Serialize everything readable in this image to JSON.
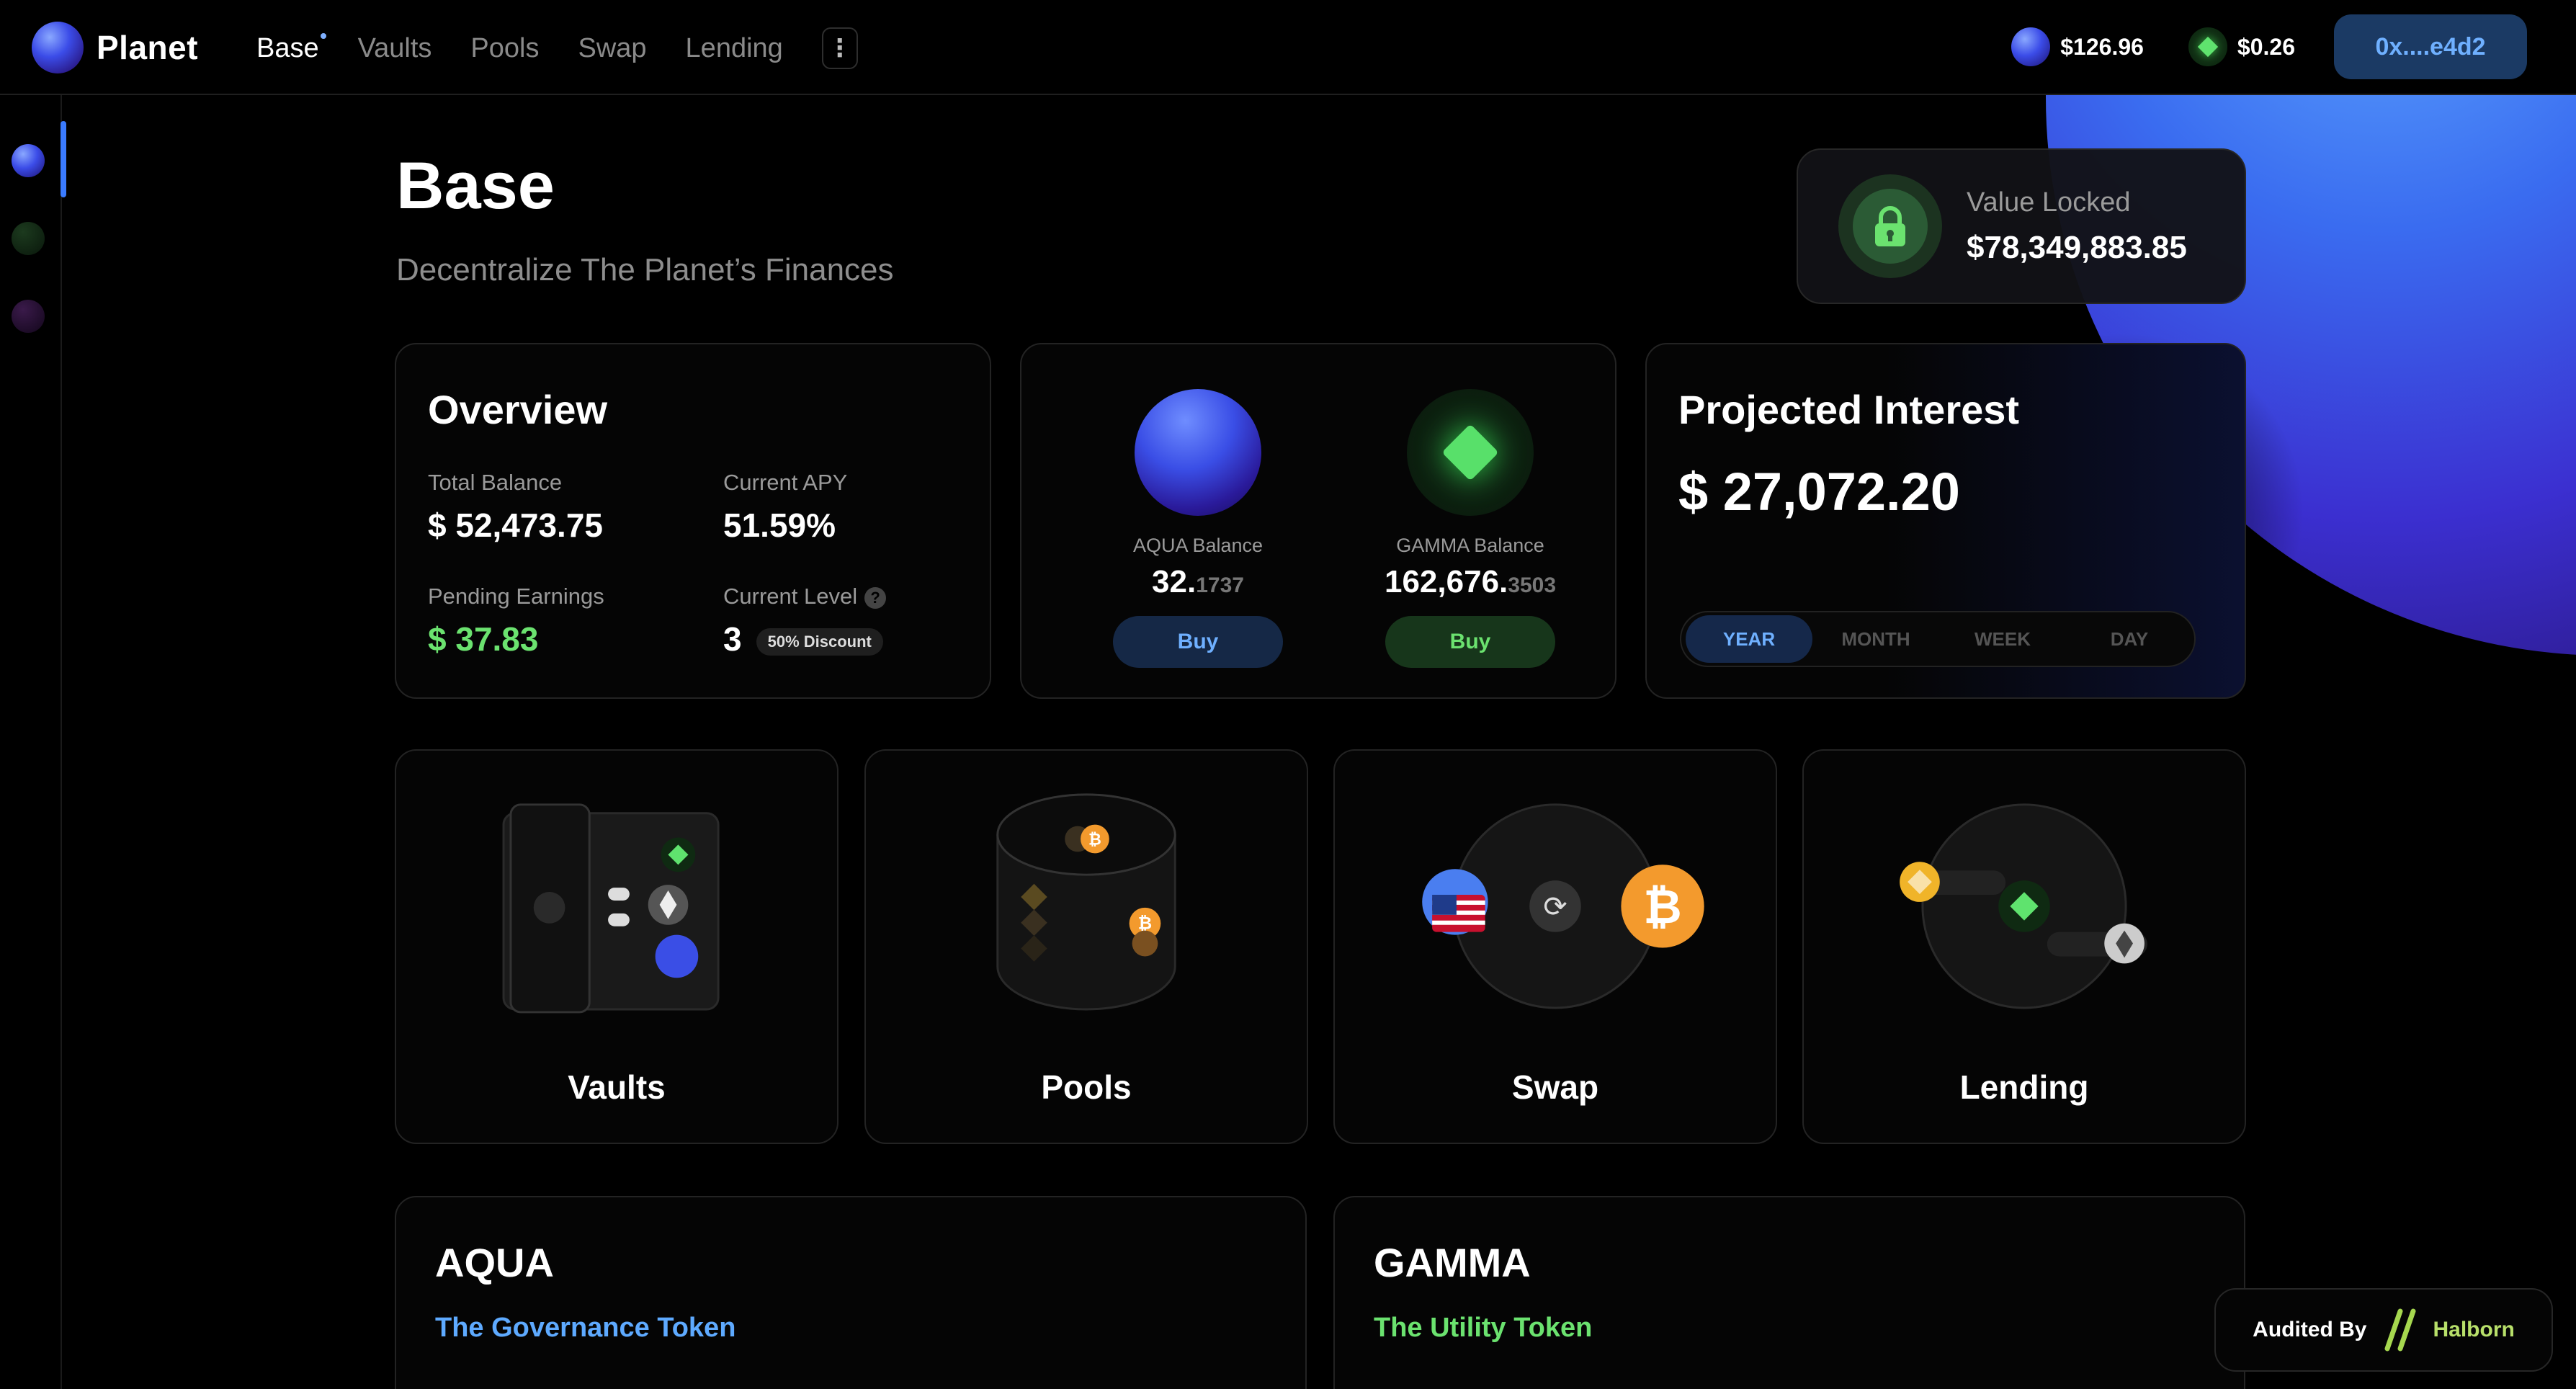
{
  "app": {
    "brand": "Planet"
  },
  "nav": {
    "items": [
      {
        "label": "Base",
        "active": true
      },
      {
        "label": "Vaults",
        "active": false
      },
      {
        "label": "Pools",
        "active": false
      },
      {
        "label": "Swap",
        "active": false
      },
      {
        "label": "Lending",
        "active": false
      }
    ],
    "more_icon": "more-vertical-icon"
  },
  "prices": {
    "aqua": "$126.96",
    "gamma": "$0.26"
  },
  "wallet": {
    "address": "0x....e4d2"
  },
  "header": {
    "title": "Base",
    "subtitle": "Decentralize The Planet’s Finances"
  },
  "tvl": {
    "label": "Value Locked",
    "value": "$78,349,883.85",
    "icon": "lock-icon"
  },
  "overview": {
    "title": "Overview",
    "total_balance_label": "Total Balance",
    "total_balance": "$ 52,473.75",
    "apy_label": "Current APY",
    "apy": "51.59%",
    "pending_label": "Pending Earnings",
    "pending": "$ 37.83",
    "level_label": "Current Level",
    "level": "3",
    "discount": "50% Discount",
    "help_icon": "question-icon"
  },
  "balances": {
    "aqua": {
      "label": "AQUA Balance",
      "int": "32.",
      "dec": "1737",
      "buy": "Buy"
    },
    "gamma": {
      "label": "GAMMA Balance",
      "int": "162,676.",
      "dec": "3503",
      "buy": "Buy"
    }
  },
  "projected": {
    "title": "Projected Interest",
    "value": "$ 27,072.20",
    "periods": [
      "YEAR",
      "MONTH",
      "WEEK",
      "DAY"
    ],
    "active_period": "YEAR"
  },
  "features": [
    {
      "label": "Vaults",
      "icon": "vault-icon"
    },
    {
      "label": "Pools",
      "icon": "pool-icon"
    },
    {
      "label": "Swap",
      "icon": "swap-icon"
    },
    {
      "label": "Lending",
      "icon": "lending-icon"
    }
  ],
  "tokens": {
    "aqua": {
      "title": "AQUA",
      "subtitle": "The Governance Token"
    },
    "gamma": {
      "title": "GAMMA",
      "subtitle": "The Utility Token"
    }
  },
  "audit": {
    "by": "Audited By",
    "name": "Halborn"
  },
  "colors": {
    "accent_blue": "#6fb0ff",
    "accent_green": "#6be26f",
    "background": "#000000"
  }
}
